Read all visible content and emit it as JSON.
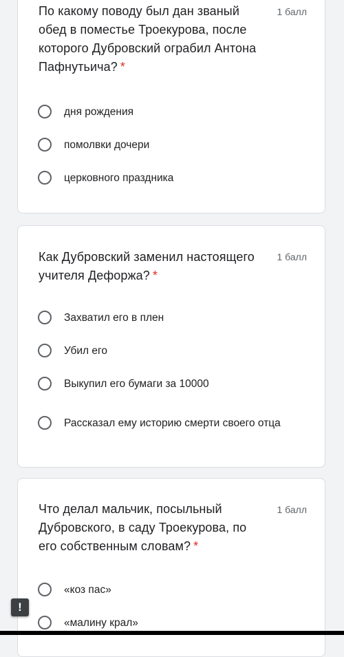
{
  "questions": [
    {
      "title": "По какому поводу был дан званый обед в поместье Троекурова, после которого Дубровский ограбил Антона Пафнутьича?",
      "required_mark": "*",
      "points": "1 балл",
      "options": [
        "дня рождения",
        "помолвки дочери",
        "церковного праздника"
      ]
    },
    {
      "title": "Как Дубровский заменил настоящего учителя Дефоржа?",
      "required_mark": "*",
      "points": "1 балл",
      "options": [
        "Захватил его в плен",
        "Убил его",
        "Выкупил его бумаги за 10000",
        "Рассказал ему историю смерти своего отца"
      ]
    },
    {
      "title": "Что делал мальчик, посыльный Дубровского, в саду Троекурова, по его собственным словам?",
      "required_mark": "*",
      "points": "1 балл",
      "options": [
        "«коз пас»",
        "«малину крал»"
      ]
    }
  ],
  "feedback": {
    "icon": "exclamation-icon",
    "glyph": "!"
  },
  "colors": {
    "background": "#f1f3f4",
    "card": "#ffffff",
    "required": "#d93025",
    "radio_border": "#5f6368"
  }
}
